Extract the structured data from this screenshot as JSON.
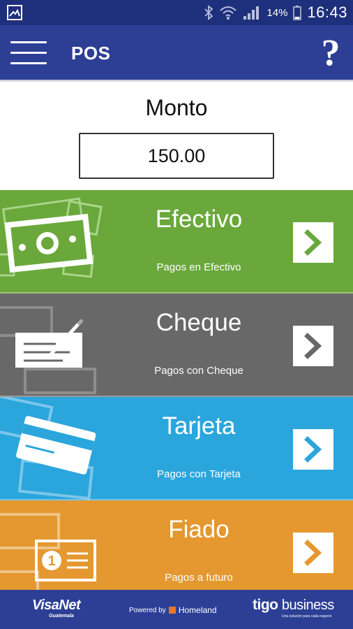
{
  "status_bar": {
    "battery_percent": "14%",
    "time": "16:43",
    "icons": [
      "image-notification-icon",
      "bluetooth-icon",
      "wifi-icon",
      "signal-icon",
      "battery-icon"
    ]
  },
  "app_bar": {
    "title": "POS",
    "help_label": "?",
    "menu_icon": "hamburger-menu-icon"
  },
  "amount": {
    "label": "Monto",
    "value": "150.00"
  },
  "payment_options": [
    {
      "title": "Efectivo",
      "subtitle": "Pagos en Efectivo",
      "color": "#6aa83b",
      "icon": "cash-icon"
    },
    {
      "title": "Cheque",
      "subtitle": "Pagos con Cheque",
      "color": "#686868",
      "icon": "check-icon"
    },
    {
      "title": "Tarjeta",
      "subtitle": "Pagos con Tarjeta",
      "color": "#2ba6dc",
      "icon": "card-icon"
    },
    {
      "title": "Fiado",
      "subtitle": "Pagos a futuro",
      "color": "#e4982f",
      "icon": "credit-ledger-icon"
    }
  ],
  "footer": {
    "visanet": "VisaNet",
    "visanet_sub": "Guatemala",
    "powered_by": "Powered by",
    "homeland": "Homeland",
    "tigo": "tigo",
    "business": "business",
    "tigo_sub": "Una solución para cada negocio"
  },
  "colors": {
    "status_bar": "#1e2f7c",
    "app_bar": "#2c3f95",
    "footer": "#2c3f95"
  }
}
